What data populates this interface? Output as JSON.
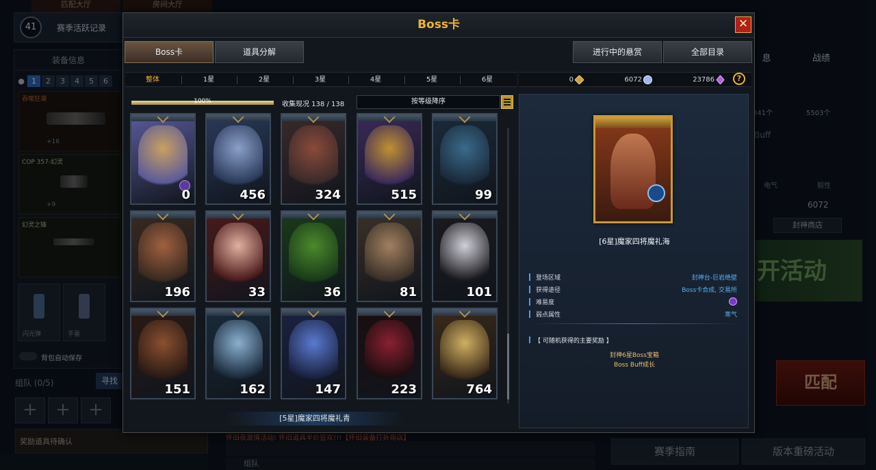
{
  "background": {
    "top_tabs": [
      "匹配大厅",
      "房间大厅"
    ],
    "season_level": "41",
    "season_record": "赛季活跃记录",
    "equipment_header": "装备信息",
    "slot_numbers": [
      "1",
      "2",
      "3",
      "4",
      "5",
      "6"
    ],
    "weapons": [
      {
        "name": "吞噬狂潮",
        "count": "+16"
      },
      {
        "name": "COP 357-幻灵",
        "count": "+9"
      },
      {
        "name": "幻灵之锋",
        "count": ""
      }
    ],
    "items": [
      {
        "name": "闪光弹"
      },
      {
        "name": "手雷"
      }
    ],
    "auto_save": "背包自动保存",
    "team": "组队 (0/5)",
    "find_button": "寻找",
    "reward_confirm": "奖励道具待确认",
    "right_tabs": [
      "息",
      "战绩"
    ],
    "buff_label": "Buff",
    "counts": [
      "341个",
      "5503个"
    ],
    "element_labels": [
      "电气",
      "毅性"
    ],
    "currency_value": "6072",
    "shop_button": "封神商店",
    "event_banner": "开活动",
    "match_button": "匹配",
    "guide_button": "赛季指南",
    "version_button": "版本重磅活动",
    "marquee_text": "怀旧夜激情活动!  怀旧道具半价狂欢!!!【怀旧装备打折商店】",
    "chat_label": "组队"
  },
  "modal": {
    "title": "Boss卡",
    "close_icon": "close-icon",
    "tabs": [
      "Boss卡",
      "道具分解"
    ],
    "right_buttons": [
      "进行中的悬赏",
      "全部目录"
    ],
    "star_filters": [
      "整体",
      "1星",
      "2星",
      "3星",
      "4星",
      "5星",
      "6星"
    ],
    "currencies": [
      {
        "value": "0",
        "icon": "gold-diamond-icon",
        "color": "#c8a040"
      },
      {
        "value": "6072",
        "icon": "crystal-ball-icon",
        "color": "#a0b8e8"
      },
      {
        "value": "23786",
        "icon": "purple-gem-icon",
        "color": "#b060e0"
      }
    ],
    "help": "?",
    "progress": {
      "percent": 100,
      "label": "100%"
    },
    "collect": "收集现况 138 / 138",
    "sort": "按等级降序",
    "cards": [
      {
        "count": "0",
        "c1": "#5a5a9a",
        "c2": "#c8a060"
      },
      {
        "count": "456",
        "c1": "#2a3a5a",
        "c2": "#8aa0c8"
      },
      {
        "count": "324",
        "c1": "#3a2a2a",
        "c2": "#8a4a3a"
      },
      {
        "count": "515",
        "c1": "#3a2a5a",
        "c2": "#c09030"
      },
      {
        "count": "99",
        "c1": "#1a2a3a",
        "c2": "#3a6a8a"
      },
      {
        "count": "196",
        "c1": "#3a2a20",
        "c2": "#a06040"
      },
      {
        "count": "33",
        "c1": "#4a1a1a",
        "c2": "#e0b0a0"
      },
      {
        "count": "36",
        "c1": "#1a3a1a",
        "c2": "#4a8a2a"
      },
      {
        "count": "81",
        "c1": "#3a3028",
        "c2": "#a08060"
      },
      {
        "count": "101",
        "c1": "#1a1a1e",
        "c2": "#d0d0d8"
      },
      {
        "count": "151",
        "c1": "#2a1a14",
        "c2": "#8a5030"
      },
      {
        "count": "162",
        "c1": "#1a2a3a",
        "c2": "#8ab0d0"
      },
      {
        "count": "147",
        "c1": "#1a2240",
        "c2": "#5a7ad0"
      },
      {
        "count": "223",
        "c1": "#1a0e10",
        "c2": "#8a2030"
      },
      {
        "count": "764",
        "c1": "#3a2a1a",
        "c2": "#d0b060"
      }
    ],
    "bottom_label": "[5星]魔家四将魔礼青",
    "detail": {
      "name": "[6星]魔家四将魔礼海",
      "attributes": [
        {
          "key": "登场区域",
          "value": "封神台-巨岩绝壁"
        },
        {
          "key": "获得途径",
          "value": "Boss卡合成, 交易所"
        },
        {
          "key": "难易度",
          "value": ""
        },
        {
          "key": "弱点属性",
          "value": "寒气"
        }
      ],
      "reward_header": "【 可随机获得的主要奖励 】",
      "rewards": [
        "封神6星Boss宝箱",
        "Boss Buff成长"
      ]
    }
  }
}
